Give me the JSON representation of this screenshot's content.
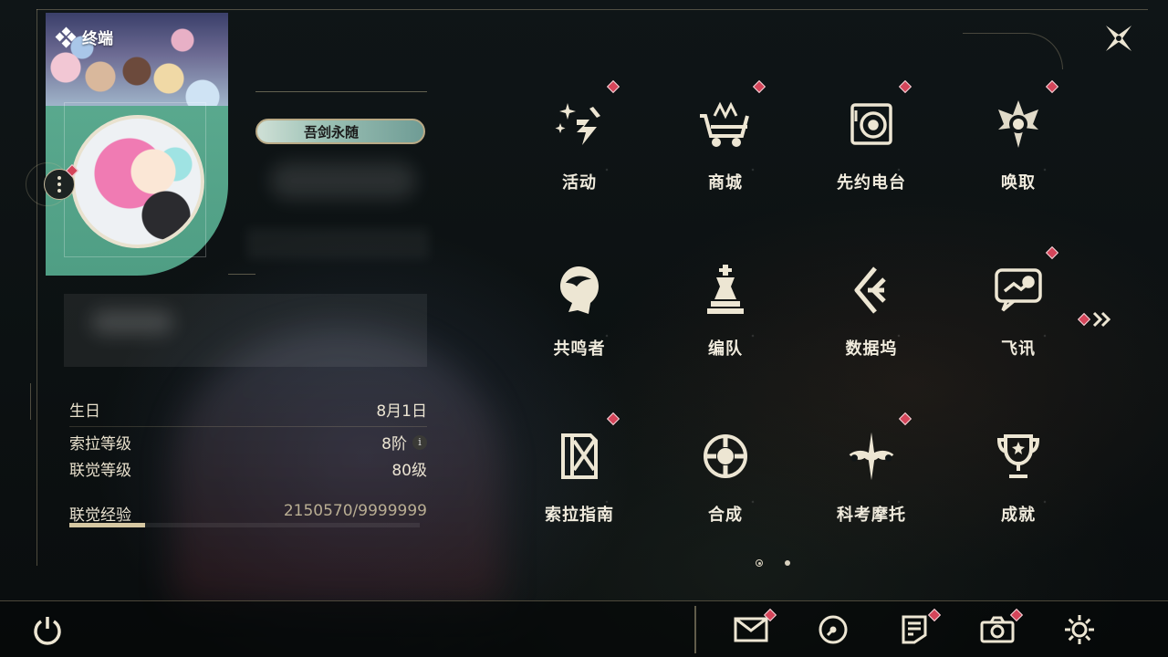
{
  "header": {
    "title": "终端"
  },
  "profile": {
    "title_badge": "吾剑永随",
    "stats": [
      {
        "label": "生日",
        "value": "8月1日"
      },
      {
        "label": "索拉等级",
        "value": "8阶"
      },
      {
        "label": "联觉等级",
        "value": "80级"
      }
    ],
    "exp": {
      "label": "联觉经验",
      "value": "2150570/9999999",
      "progress": 0.215
    }
  },
  "menu": {
    "items": [
      {
        "label": "活动",
        "icon": "sparkle-icon",
        "badge": true
      },
      {
        "label": "商城",
        "icon": "cart-icon",
        "badge": true
      },
      {
        "label": "先约电台",
        "icon": "radio-icon",
        "badge": true
      },
      {
        "label": "唤取",
        "icon": "compass-icon",
        "badge": true
      },
      {
        "label": "共鸣者",
        "icon": "character-icon",
        "badge": false
      },
      {
        "label": "编队",
        "icon": "chess-icon",
        "badge": false
      },
      {
        "label": "数据坞",
        "icon": "data-dock-icon",
        "badge": false
      },
      {
        "label": "飞讯",
        "icon": "message-icon",
        "badge": true
      },
      {
        "label": "索拉指南",
        "icon": "guide-icon",
        "badge": true
      },
      {
        "label": "合成",
        "icon": "synthesis-icon",
        "badge": false
      },
      {
        "label": "科考摩托",
        "icon": "motorbike-icon",
        "badge": true
      },
      {
        "label": "成就",
        "icon": "trophy-icon",
        "badge": false
      }
    ],
    "page_count": 2,
    "active_page": 1
  },
  "colors": {
    "accent": "#d6c8a2",
    "badge": "#d4455a",
    "card": "#5fae93"
  },
  "bottom_bar": {
    "left": [
      "power-icon"
    ],
    "right": [
      "mail-icon",
      "clock-icon",
      "notice-icon",
      "camera-icon",
      "settings-icon"
    ]
  }
}
